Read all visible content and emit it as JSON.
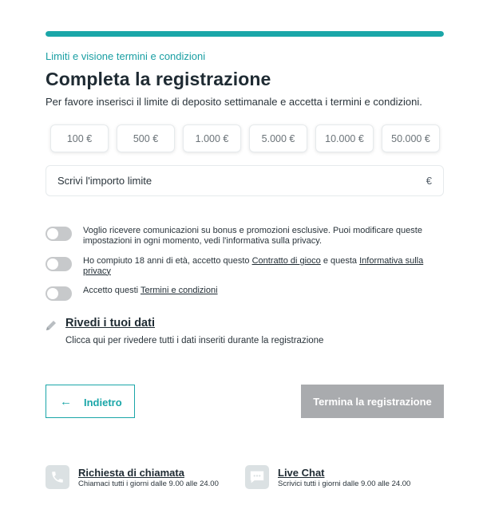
{
  "progress": {
    "fraction": 1.0,
    "color": "#1aa6a8"
  },
  "step_label": "Limiti e visione termini e condizioni",
  "title": "Completa la registrazione",
  "subtitle": "Per favore inserisci il limite di deposito settimanale e accetta i termini e condizioni.",
  "amounts": [
    "100 €",
    "500 €",
    "1.000 €",
    "5.000 €",
    "10.000 €",
    "50.000 €"
  ],
  "limit_input": {
    "placeholder": "Scrivi l'importo limite",
    "value": "",
    "currency": "€"
  },
  "consents": [
    {
      "checked": false,
      "text": "Voglio ricevere comunicazioni su bonus e promozioni esclusive. Puoi modificare queste impostazioni in ogni momento, vedi l'informativa sulla privacy."
    },
    {
      "checked": false,
      "text_before": "Ho compiuto 18 anni di età, accetto questo ",
      "link1": "Contratto di gioco",
      "text_middle": " e questa ",
      "link2": "Informativa sulla privacy"
    },
    {
      "checked": false,
      "text_before": "Accetto questi ",
      "link1": "Termini e condizioni"
    }
  ],
  "review": {
    "icon": "pencil-icon",
    "title": "Rivedi i tuoi dati",
    "description": "Clicca qui per rivedere tutti i dati inseriti durante la registrazione"
  },
  "buttons": {
    "back": "Indietro",
    "finish": "Termina la registrazione"
  },
  "help": [
    {
      "icon": "phone-icon",
      "title": "Richiesta di chiamata",
      "subtitle": "Chiamaci tutti i giorni dalle 9.00 alle 24.00"
    },
    {
      "icon": "chat-icon",
      "title": "Live Chat",
      "subtitle": "Scrivici tutti i giorni dalle 9.00 alle 24.00"
    }
  ],
  "colors": {
    "accent": "#1aa6a8",
    "disabled": "#a9abae",
    "toggle_off": "#c7c9cb"
  }
}
